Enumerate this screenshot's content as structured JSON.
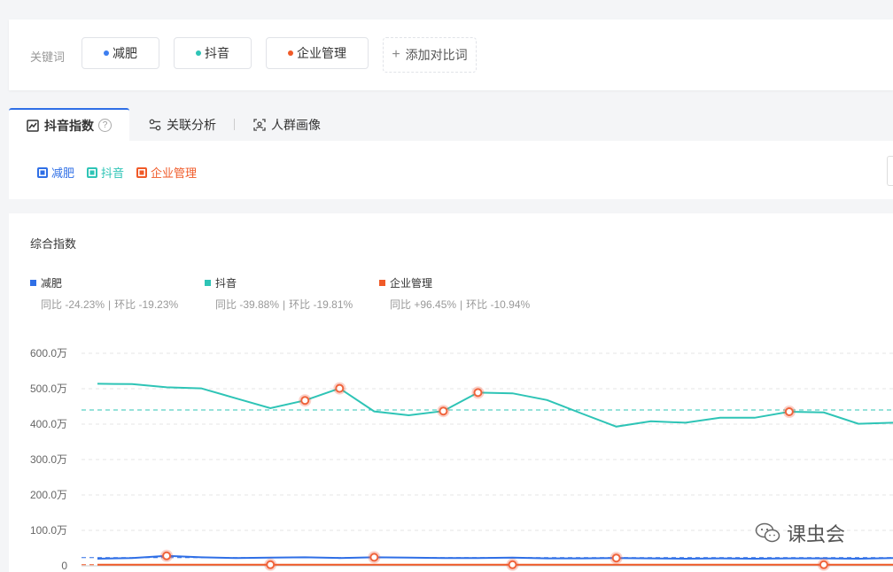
{
  "keywords": {
    "label": "关键词",
    "items": [
      {
        "name": "减肥",
        "color": "#3d7ef0"
      },
      {
        "name": "抖音",
        "color": "#2ec4b6"
      },
      {
        "name": "企业管理",
        "color": "#f05a28"
      }
    ],
    "add_label": "添加对比词"
  },
  "tabs": [
    {
      "label": "抖音指数",
      "icon": "trend-chart-icon",
      "active": true
    },
    {
      "label": "关联分析",
      "icon": "relation-icon"
    },
    {
      "label": "人群画像",
      "icon": "portrait-icon"
    }
  ],
  "filters": [
    {
      "name": "减肥",
      "color": "#2f6fe6"
    },
    {
      "name": "抖音",
      "color": "#2ec4b6"
    },
    {
      "name": "企业管理",
      "color": "#f05a28"
    }
  ],
  "chart_title": "综合指数",
  "legend": [
    {
      "name": "减肥",
      "color": "#2f6fe6",
      "yoy": "同比 -24.23%",
      "mom": "环比 -19.23%"
    },
    {
      "name": "抖音",
      "color": "#2ec4b6",
      "yoy": "同比 -39.88%",
      "mom": "环比 -19.81%"
    },
    {
      "name": "企业管理",
      "color": "#f05a28",
      "yoy": "同比 +96.45%",
      "mom": "环比 -10.94%"
    }
  ],
  "watermark": "课虫会",
  "chart_data": {
    "type": "line",
    "title": "",
    "ylabel": "",
    "xlabel": "",
    "yticks": [
      "0",
      "100.0万",
      "200.0万",
      "300.0万",
      "400.0万",
      "500.0万",
      "600.0万"
    ],
    "ylim": [
      0,
      600
    ],
    "unit": "万",
    "grid": true,
    "series": [
      {
        "name": "抖音",
        "color": "#2ec4b6",
        "average": 440,
        "values": [
          514,
          513,
          504,
          501,
          473,
          445,
          467,
          501,
          436,
          425,
          437,
          489,
          487,
          468,
          430,
          393,
          408,
          404,
          418,
          418,
          435,
          433,
          401,
          404
        ],
        "highlight_points": [
          6,
          7,
          10,
          11,
          20
        ]
      },
      {
        "name": "减肥",
        "color": "#2f6fe6",
        "average": 23,
        "values": [
          20,
          22,
          28,
          24,
          22,
          23,
          24,
          22,
          24,
          23,
          22,
          22,
          23,
          21,
          21,
          22,
          21,
          20,
          21,
          20,
          21,
          21,
          20,
          22
        ],
        "highlight_points": [
          2,
          8,
          15
        ]
      },
      {
        "name": "企业管理",
        "color": "#f05a28",
        "average": 3,
        "values": [
          3,
          3,
          3,
          3,
          3,
          3,
          3,
          3,
          3,
          3,
          3,
          3,
          3,
          3,
          3,
          3,
          3,
          3,
          3,
          3,
          3,
          3,
          3,
          3
        ],
        "highlight_points": [
          5,
          12,
          21
        ]
      }
    ]
  }
}
